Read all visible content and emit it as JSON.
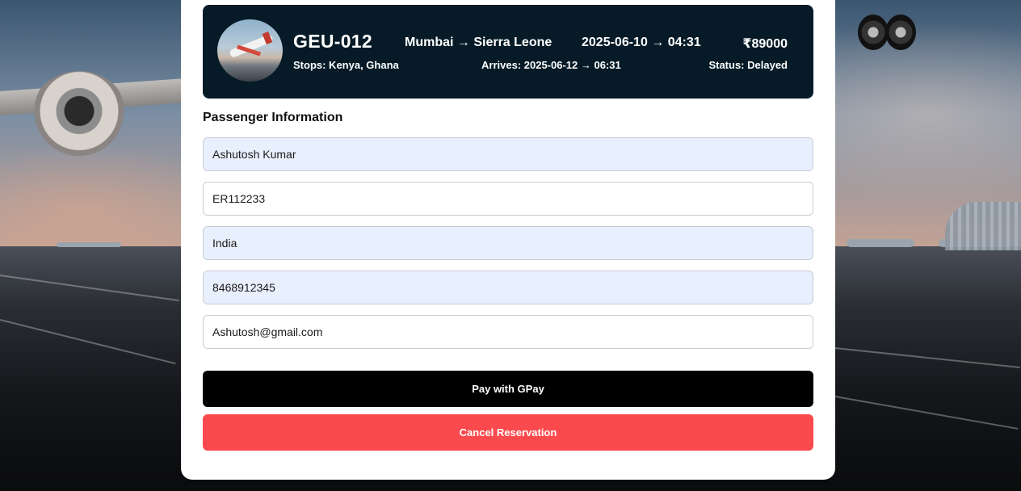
{
  "flight": {
    "code": "GEU-012",
    "route": "Mumbai → Sierra Leone",
    "departure": "2025-06-10 → 04:31",
    "price": "₹89000",
    "stops": "Stops: Kenya, Ghana",
    "arrives": "Arrives: 2025-06-12 → 06:31",
    "status": "Status: Delayed"
  },
  "passenger": {
    "section_title": "Passenger Information",
    "name": "Ashutosh Kumar",
    "passport": "ER112233",
    "nationality": "India",
    "phone": "8468912345",
    "email": "Ashutosh@gmail.com"
  },
  "actions": {
    "pay_label": "Pay with GPay",
    "cancel_label": "Cancel Reservation"
  },
  "colors": {
    "flight_card_bg": "#061b27",
    "filled_input_bg": "#e8effd",
    "pay_button": "#000000",
    "cancel_button": "#fb4a4d"
  }
}
